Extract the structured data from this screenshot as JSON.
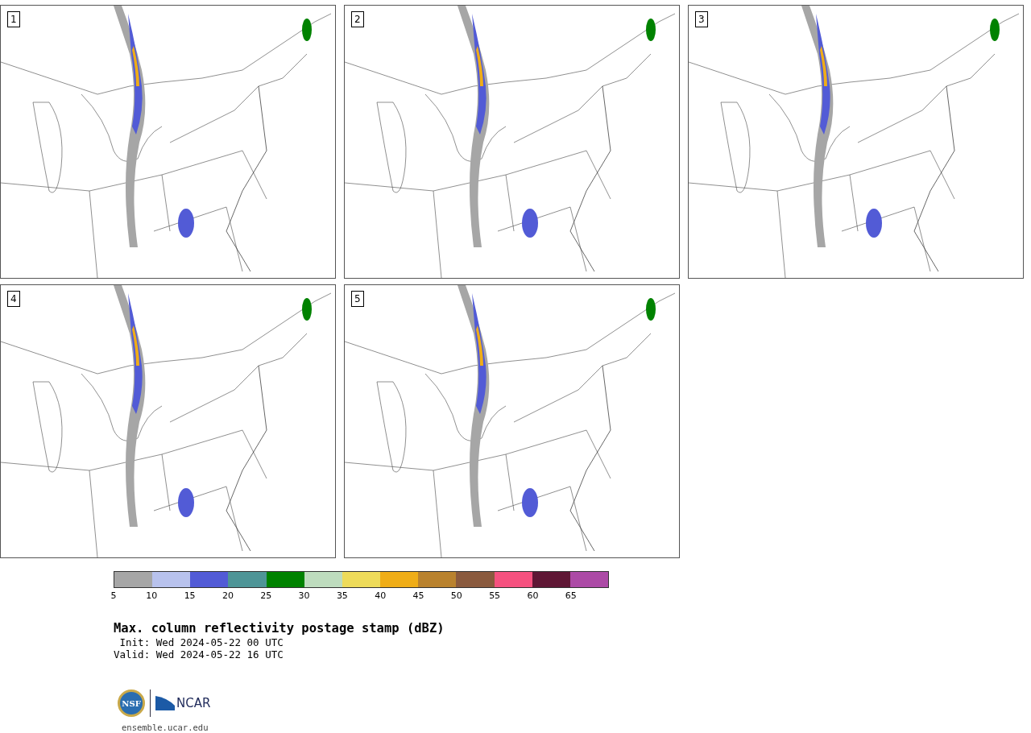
{
  "panels": [
    {
      "label": "1"
    },
    {
      "label": "2"
    },
    {
      "label": "3"
    },
    {
      "label": "4"
    },
    {
      "label": "5"
    }
  ],
  "colorbar": {
    "segments": [
      {
        "color": "#a6a6a6",
        "tick": "5"
      },
      {
        "color": "#b8c2ed",
        "tick": "10"
      },
      {
        "color": "#525bd6",
        "tick": "15"
      },
      {
        "color": "#4e9597",
        "tick": "20"
      },
      {
        "color": "#008200",
        "tick": "25"
      },
      {
        "color": "#bedcbe",
        "tick": "30"
      },
      {
        "color": "#eedb5a",
        "tick": "35"
      },
      {
        "color": "#efad17",
        "tick": "40"
      },
      {
        "color": "#b9822e",
        "tick": "45"
      },
      {
        "color": "#8a5a3e",
        "tick": "50"
      },
      {
        "color": "#f5517f",
        "tick": "55"
      },
      {
        "color": "#5f1735",
        "tick": "60"
      },
      {
        "color": "#ac4aa6",
        "tick": "65"
      }
    ]
  },
  "title": "Max. column reflectivity postage stamp (dBZ)",
  "init": " Init: Wed 2024-05-22 00 UTC",
  "valid": "Valid: Wed 2024-05-22 16 UTC",
  "logo": {
    "left": "NSF",
    "right": "NCAR"
  },
  "footer": "ensemble.ucar.edu"
}
